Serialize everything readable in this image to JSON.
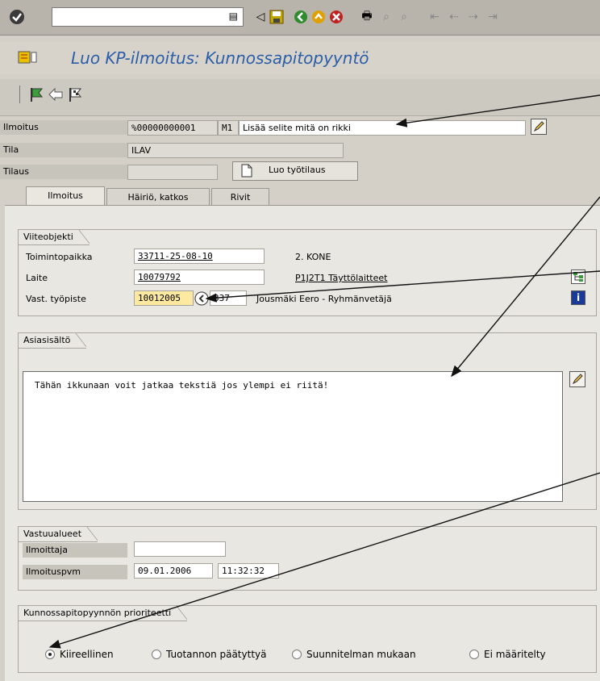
{
  "toolbar": {
    "command_field_value": "",
    "icons": [
      "check-icon",
      "enter-icon",
      "back-icon",
      "save-icon",
      "nav-back-icon",
      "nav-exit-icon",
      "cancel-icon",
      "print-icon",
      "find-icon",
      "find-next-icon",
      "first-page-icon",
      "prev-page-icon",
      "next-page-icon",
      "last-page-icon"
    ]
  },
  "title": "Luo KP-ilmoitus: Kunnossapitopyyntö",
  "header": {
    "ilmoitus_label": "Ilmoitus",
    "ilmoitus_number": "%00000000001",
    "ilmoitus_type": "M1",
    "ilmoitus_text": "Lisää selite mitä on rikki",
    "tila_label": "Tila",
    "tila_value": "ILAV",
    "tilaus_label": "Tilaus",
    "tilaus_value": "",
    "luo_button": "Luo työtilaus"
  },
  "tabs": [
    {
      "label": "Ilmoitus",
      "active": true
    },
    {
      "label": "Häiriö, katkos",
      "active": false
    },
    {
      "label": "Rivit",
      "active": false
    }
  ],
  "viiteobjekti": {
    "title": "Viiteobjekti",
    "rows": [
      {
        "label": "Toimintopaikka",
        "value": "33711-25-08-10",
        "extra": "",
        "desc": "2. KONE"
      },
      {
        "label": "Laite",
        "value": "10079792",
        "extra": "",
        "desc": "P1J2T1 Täyttölaitteet"
      },
      {
        "label": "Vast. työpiste",
        "value": "10012005",
        "extra": "337",
        "desc": "Jousmäki Eero - Ryhmänvetäjä"
      }
    ]
  },
  "asiasisalto": {
    "title": "Asiasisältö",
    "text": "Tähän ikkunaan voit jatkaa tekstiä jos ylempi ei riitä!"
  },
  "vastuualueet": {
    "title": "Vastuualueet",
    "ilmoittaja_label": "Ilmoittaja",
    "ilmoittaja_value": "",
    "ilmoituspvm_label": "Ilmoituspvm",
    "date": "09.01.2006",
    "time": "11:32:32"
  },
  "prioriteetti": {
    "title": "Kunnossapitopyynnön prioriteetti",
    "options": [
      {
        "label": "Kiireellinen",
        "selected": true
      },
      {
        "label": "Tuotannon päätyttyä",
        "selected": false
      },
      {
        "label": "Suunnitelman mukaan",
        "selected": false
      },
      {
        "label": "Ei määritelty",
        "selected": false
      }
    ]
  },
  "colors": {
    "title": "#2b5ea8",
    "background": "#d4d0c8",
    "panel": "#e9e7e2",
    "required_field": "#fdeaa0"
  }
}
